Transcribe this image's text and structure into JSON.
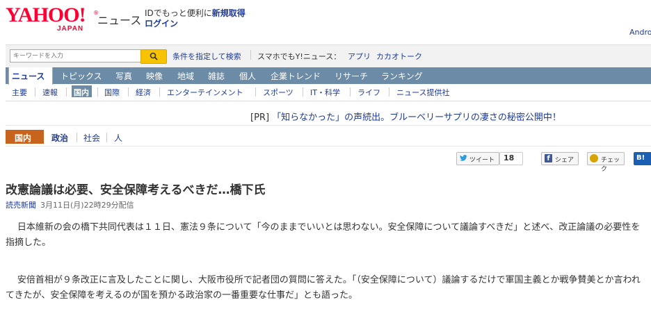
{
  "header": {
    "logo_word": "YAHOO!",
    "logo_sub": "JAPAN",
    "logo_reg": "®",
    "brand": "ニュース",
    "id_message": "IDでもっと便利に",
    "id_register": "新規取得",
    "login": "ログイン",
    "right_text": "Andro"
  },
  "search": {
    "placeholder": "キーワードを入力",
    "advanced": "条件を指定して検索",
    "smartphone_label": "スマホでもY!ニュース：",
    "app": "アプリ",
    "kakao": "カカオトーク"
  },
  "main_nav": [
    "ニュース",
    "トピックス",
    "写真",
    "映像",
    "地域",
    "雑誌",
    "個人",
    "企業トレンド",
    "リサーチ",
    "ランキング"
  ],
  "sub_nav": [
    "主要",
    "速報",
    "国内",
    "国際",
    "経済",
    "エンターテインメント",
    "スポーツ",
    "IT・科学",
    "ライフ",
    "ニュース提供社"
  ],
  "pr": {
    "tag": "[PR]",
    "text": "「知らなかった」の声続出。ブルーベリーサプリの凄さの秘密公開中！"
  },
  "category_nav": [
    "国内",
    "政治",
    "社会",
    "人"
  ],
  "social": {
    "tweet": "ツイート",
    "tweet_count": "18",
    "share": "シェア",
    "check": "チェック",
    "bl": "B!"
  },
  "article": {
    "headline": "改憲論議は必要、安全保障考えるべきだ…橋下氏",
    "source": "読売新聞",
    "date": "3月11日(月)22時29分配信",
    "paragraphs": [
      "日本維新の会の橋下共同代表は１１日、憲法９条について「今のままでいいとは思わない。安全保障について議論すべきだ」と述べ、改正論議の必要性を指摘した。",
      "安倍首相が９条改正に言及したことに関し、大阪市役所で記者団の質問に答えた。「（安全保障について）議論するだけで軍国主義とか戦争賛美とか言われてきたが、安全保障を考えるのが国を預かる政治家の一番重要な仕事だ」とも語った。"
    ]
  },
  "colors": {
    "logo_red": "#ff0033",
    "link_blue": "#1e3a9c",
    "nav_bg": "#6c8ba6",
    "category_orange": "#c8631e",
    "search_button": "#f7c300"
  }
}
